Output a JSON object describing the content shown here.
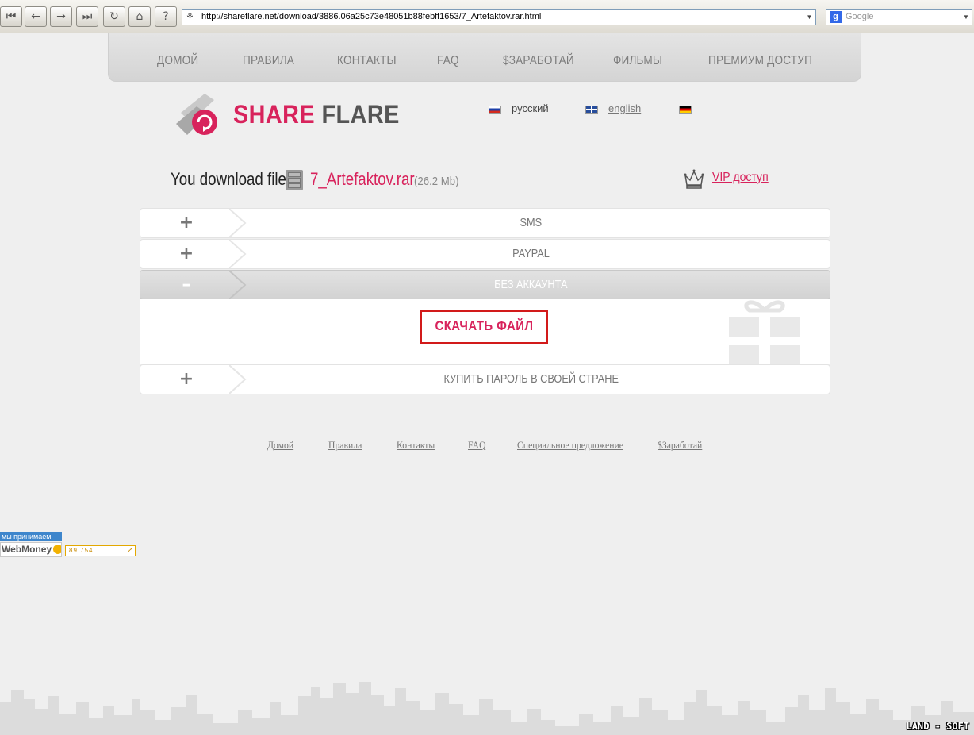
{
  "browser": {
    "url": "http://shareflare.net/download/3886.06a25c73e48051b88febff1653/7_Artefaktov.rar.html",
    "search_placeholder": "Google",
    "buttons": [
      "first",
      "back",
      "forward",
      "last",
      "reload",
      "home",
      "info"
    ]
  },
  "nav": {
    "items": [
      "ДОМОЙ",
      "ПРАВИЛА",
      "КОНТАКТЫ",
      "FAQ",
      "$ЗАРАБОТАЙ",
      "ФИЛЬМЫ",
      "ПРЕМИУМ ДОСТУП"
    ]
  },
  "logo": {
    "part1": "SHARE",
    "part2": "FLARE"
  },
  "languages": {
    "ru": "русский",
    "en": "english"
  },
  "download": {
    "label": "You download file",
    "filename": "7_Artefaktov.rar",
    "size": "(26.2 Mb)",
    "vip": "VIP доступ"
  },
  "accordion": {
    "sms": {
      "toggle": "+",
      "label": "SMS"
    },
    "paypal": {
      "toggle": "+",
      "label": "PAYPAL"
    },
    "no_account": {
      "toggle": "–",
      "label": "БЕЗ АККАУНТА"
    },
    "buy_password": {
      "toggle": "+",
      "label": "КУПИТЬ ПАРОЛЬ В СВОЕЙ СТРАНЕ"
    },
    "download_button": "СКАЧАТЬ ФАЙЛ"
  },
  "footer": {
    "links": [
      "Домой",
      "Правила",
      "Контакты",
      "FAQ",
      "Специальное предложение",
      "$Заработай"
    ]
  },
  "webmoney": {
    "accept": "мы принимаем",
    "brand": "WebMoney",
    "attestat": "89 754"
  },
  "watermark": "LAND - SOFT",
  "colors": {
    "brand_pink": "#d8235c",
    "highlight_red": "#d21a1a"
  }
}
